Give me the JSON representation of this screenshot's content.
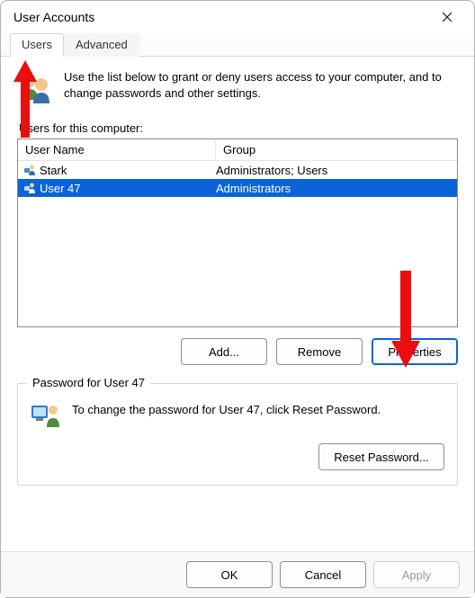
{
  "window": {
    "title": "User Accounts"
  },
  "tabs": [
    {
      "label": "Users",
      "active": true
    },
    {
      "label": "Advanced",
      "active": false
    }
  ],
  "intro": "Use the list below to grant or deny users access to your computer, and to change passwords and other settings.",
  "users_label": "Users for this computer:",
  "columns": {
    "name": "User Name",
    "group": "Group"
  },
  "rows": [
    {
      "name": "Stark",
      "group": "Administrators; Users",
      "selected": false
    },
    {
      "name": "User 47",
      "group": "Administrators",
      "selected": true
    }
  ],
  "buttons": {
    "add": "Add...",
    "remove": "Remove",
    "properties": "Properties"
  },
  "password_group": {
    "legend": "Password for User 47",
    "text": "To change the password for User 47, click Reset Password.",
    "reset": "Reset Password..."
  },
  "bottom": {
    "ok": "OK",
    "cancel": "Cancel",
    "apply": "Apply"
  },
  "icons": {
    "close": "close-icon",
    "users_large": "users-large-icon",
    "user_row": "user-row-icon",
    "monitor_user": "monitor-user-icon"
  },
  "accent": "#0a64d8",
  "annotation_arrow_color": "#ea0e0e"
}
